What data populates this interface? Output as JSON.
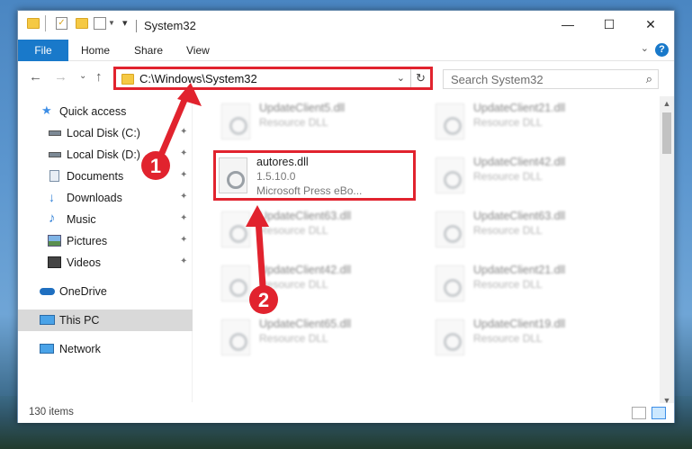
{
  "window": {
    "title": "System32",
    "minimize_glyph": "—",
    "maximize_glyph": "☐",
    "close_glyph": "✕"
  },
  "ribbon": {
    "file_label": "File",
    "tabs": [
      "Home",
      "Share",
      "View"
    ],
    "help_glyph": "?",
    "collapse_glyph": "⌄"
  },
  "nav": {
    "back_glyph": "←",
    "forward_glyph": "→",
    "recent_glyph": "⌄",
    "up_glyph": "↑",
    "address": "C:\\Windows\\System32",
    "address_dropdown_glyph": "⌄",
    "refresh_glyph": "↻"
  },
  "search": {
    "placeholder": "Search System32",
    "icon_glyph": "⌕"
  },
  "sidebar": {
    "items": [
      {
        "label": "Quick access",
        "icon": "star-icon",
        "pinned": false,
        "state": "normal"
      },
      {
        "label": "Local Disk (C:)",
        "icon": "drive-icon",
        "pinned": true,
        "state": "normal"
      },
      {
        "label": "Local Disk (D:)",
        "icon": "drive-icon",
        "pinned": true,
        "state": "normal"
      },
      {
        "label": "Documents",
        "icon": "documents-icon",
        "pinned": true,
        "state": "normal"
      },
      {
        "label": "Downloads",
        "icon": "downloads-icon",
        "pinned": true,
        "state": "normal"
      },
      {
        "label": "Music",
        "icon": "music-icon",
        "pinned": true,
        "state": "normal"
      },
      {
        "label": "Pictures",
        "icon": "pictures-icon",
        "pinned": true,
        "state": "normal"
      },
      {
        "label": "Videos",
        "icon": "videos-icon",
        "pinned": true,
        "state": "normal"
      },
      {
        "label": "OneDrive",
        "icon": "cloud-icon",
        "pinned": false,
        "state": "normal"
      },
      {
        "label": "This PC",
        "icon": "computer-icon",
        "pinned": false,
        "state": "selected"
      },
      {
        "label": "Network",
        "icon": "network-icon",
        "pinned": false,
        "state": "normal"
      }
    ],
    "pin_glyph": "📌"
  },
  "files": {
    "highlighted": {
      "name": "autores.dll",
      "version": "1.5.10.0",
      "company": "Microsoft Press eBo..."
    },
    "blurred": [
      {
        "name": "UpdateClient5.dll",
        "type": "Resource DLL"
      },
      {
        "name": "UpdateClient21.dll",
        "type": "Resource DLL"
      },
      {
        "name": "UpdateClient42.dll",
        "type": "Resource DLL"
      },
      {
        "name": "UpdateClient63.dll",
        "type": "Resource DLL"
      },
      {
        "name": "UpdateClient63.dll",
        "type": "Resource DLL"
      },
      {
        "name": "UpdateClient42.dll",
        "type": "Resource DLL"
      },
      {
        "name": "UpdateClient21.dll",
        "type": "Resource DLL"
      },
      {
        "name": "UpdateClient65.dll",
        "type": "Resource DLL"
      },
      {
        "name": "UpdateClient19.dll",
        "type": "Resource DLL"
      }
    ]
  },
  "status": {
    "item_count": "130 items"
  },
  "annotations": {
    "step1": "1",
    "step2": "2",
    "color": "#e1232e"
  }
}
